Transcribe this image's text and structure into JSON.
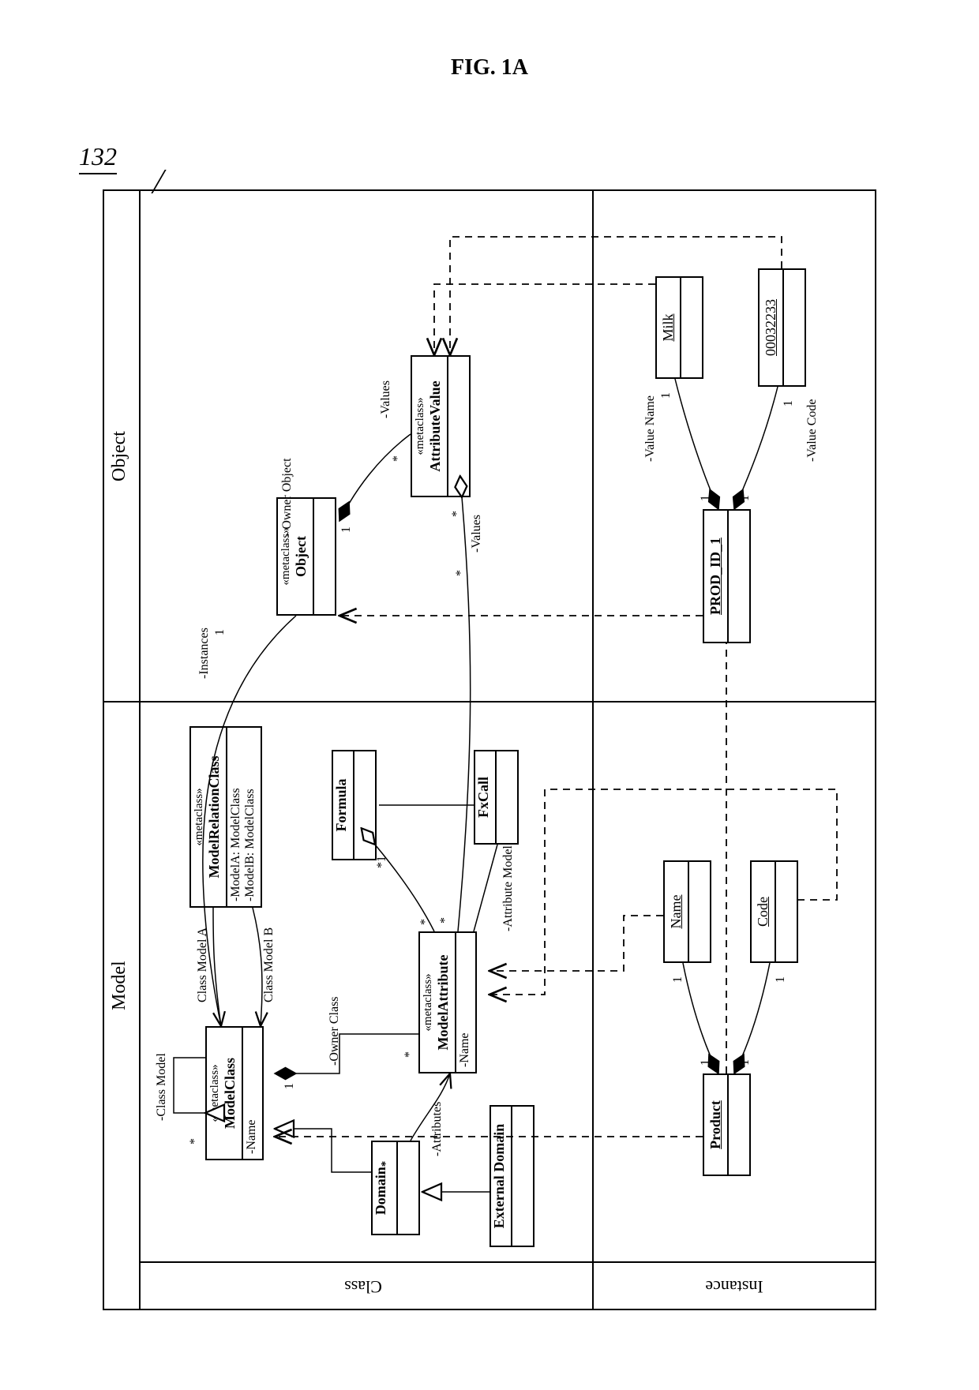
{
  "figure_title": "FIG. 1A",
  "reference_number": "132",
  "columns": {
    "model": "Model",
    "object": "Object"
  },
  "rows": {
    "class": "Class",
    "instance": "Instance"
  },
  "metaclasses": {
    "modelclass": {
      "stereotype": "«metaclass»",
      "name": "ModelClass",
      "attributes": [
        "-Name"
      ]
    },
    "modelrelationclass": {
      "stereotype": "«metaclass»",
      "name": "ModelRelationClass",
      "attributes": [
        "-ModelA: ModelClass",
        "-ModelB: ModelClass"
      ]
    },
    "modelattribute": {
      "stereotype": "«metaclass»",
      "name": "ModelAttribute",
      "attributes": [
        "-Name"
      ]
    },
    "object": {
      "stereotype": "«metaclass»",
      "name": "Object"
    },
    "attributevalue": {
      "stereotype": "«metaclass»",
      "name": "AttributeValue"
    }
  },
  "classes": {
    "domain": {
      "name": "Domain"
    },
    "externaldomain": {
      "name": "External Domain"
    },
    "formula": {
      "name": "Formula"
    },
    "fxcall": {
      "name": "FxCall"
    }
  },
  "instances": {
    "product": "Product",
    "name": "Name",
    "code": "Code",
    "prodid": "PROD_ID_1",
    "milk": "Milk",
    "codeval": "00032233"
  },
  "assoc": {
    "class_model": "-Class Model",
    "class_model_a": "Class Model A",
    "class_model_b": "Class Model B",
    "owner_class": "-Owner Class",
    "attributes": "-Attributes",
    "attribute_model": "-Attribute Model",
    "instances": "-Instances",
    "owner_object": "- Owner Object",
    "values": "-Values",
    "value_name": "-Value Name",
    "value_code": "-Value Code"
  },
  "mult": {
    "one": "1",
    "many": "*",
    "many_star": "*,",
    "one_star": "*1"
  }
}
